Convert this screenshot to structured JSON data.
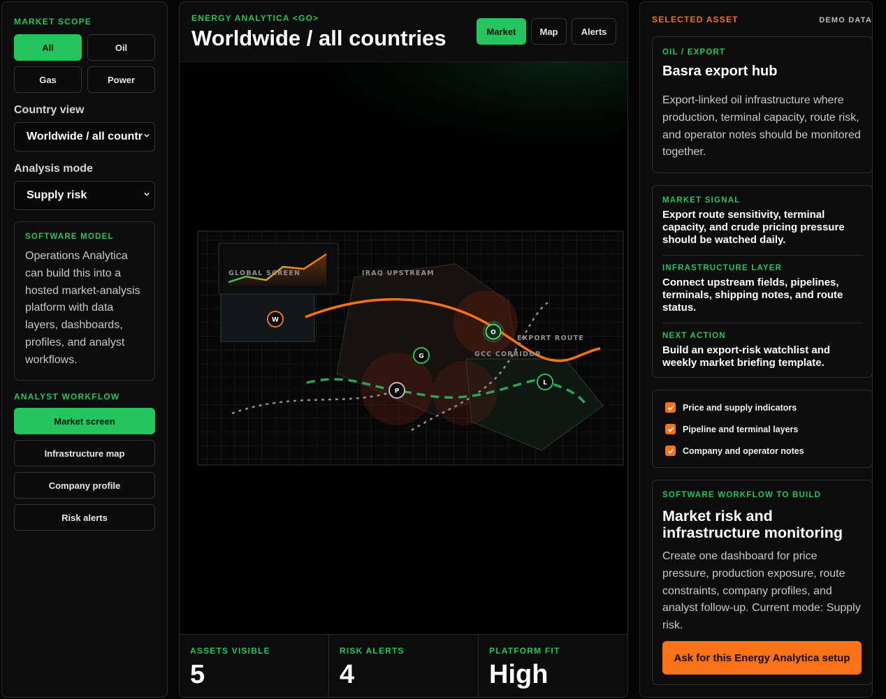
{
  "left": {
    "market_scope_title": "MARKET SCOPE",
    "scope_buttons": [
      "All",
      "Oil",
      "Gas",
      "Power"
    ],
    "country_view_label": "Country view",
    "country_view_value": "Worldwide / all countr",
    "analysis_mode_label": "Analysis mode",
    "analysis_mode_value": "Supply risk",
    "software_model": {
      "title": "SOFTWARE MODEL",
      "text": "Operations Analytica can build this into a hosted market-analysis platform with data layers, dashboards, profiles, and analyst workflows."
    },
    "analyst_workflow_title": "ANALYST WORKFLOW",
    "workflow_buttons": [
      "Market screen",
      "Infrastructure map",
      "Company profile",
      "Risk alerts"
    ]
  },
  "center": {
    "eyebrow": "ENERGY ANALYTICA <GO>",
    "title": "Worldwide / all countries",
    "tabs": [
      "Market",
      "Map",
      "Alerts"
    ],
    "map": {
      "labels": [
        "GLOBAL SCREEN",
        "IRAQ UPSTREAM",
        "EXPORT ROUTE",
        "GCC CORRIDOR"
      ],
      "markers": [
        "W",
        "G",
        "O",
        "P",
        "L"
      ]
    },
    "stats": [
      {
        "label": "ASSETS VISIBLE",
        "value": "5"
      },
      {
        "label": "RISK ALERTS",
        "value": "4"
      },
      {
        "label": "PLATFORM FIT",
        "value": "High"
      }
    ]
  },
  "right": {
    "selected_asset_title": "SELECTED ASSET",
    "demo_badge": "DEMO DATA",
    "asset": {
      "category": "OIL / EXPORT",
      "name": "Basra export hub",
      "description": "Export-linked oil infrastructure where production, terminal capacity, route risk, and operator notes should be monitored together."
    },
    "signals": [
      {
        "title": "MARKET SIGNAL",
        "text": "Export route sensitivity, terminal capacity, and crude pricing pressure should be watched daily."
      },
      {
        "title": "INFRASTRUCTURE LAYER",
        "text": "Connect upstream fields, pipelines, terminals, shipping notes, and route status."
      },
      {
        "title": "NEXT ACTION",
        "text": "Build an export-risk watchlist and weekly market briefing template."
      }
    ],
    "checks": [
      "Price and supply indicators",
      "Pipeline and terminal layers",
      "Company and operator notes"
    ],
    "workflow": {
      "title": "SOFTWARE WORKFLOW TO BUILD",
      "heading": "Market risk and infrastructure monitoring",
      "text": "Create one dashboard for price pressure, production exposure, route constraints, company profiles, and analyst follow-up. Current mode: Supply risk.",
      "cta": "Ask for this Energy Analytica setup"
    }
  },
  "colors": {
    "accent_green": "#22c55e",
    "accent_orange": "#f97316",
    "background": "#050505"
  }
}
